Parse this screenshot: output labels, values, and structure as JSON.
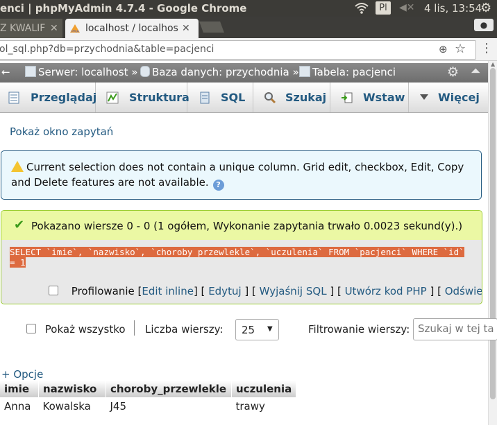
{
  "os_bar": {
    "window_title": "enci | phpMyAdmin 4.7.4 - Google Chrome",
    "keyboard_layout": "Pl",
    "clock": "4 lis, 13:54"
  },
  "browser": {
    "tabs": [
      {
        "label": "Z KWALIF"
      },
      {
        "label": "localhost / localhos"
      }
    ],
    "url": "ol_sql.php?db=przychodnia&table=pacjenci"
  },
  "breadcrumb": {
    "server": "Serwer: localhost »",
    "database": "Baza danych: przychodnia »",
    "table": "Tabela: pacjenci"
  },
  "menu_tabs": [
    {
      "label": "Przeglądaj",
      "icon": "browse-icon"
    },
    {
      "label": "Struktura",
      "icon": "structure-icon"
    },
    {
      "label": "SQL",
      "icon": "sql-icon"
    },
    {
      "label": "Szukaj",
      "icon": "search-icon"
    },
    {
      "label": "Wstaw",
      "icon": "insert-icon"
    },
    {
      "label": "Więcej",
      "icon": "chevron-down-icon"
    }
  ],
  "content": {
    "show_query_link": "Pokaż okno zapytań",
    "notice": "Current selection does not contain a unique column. Grid edit, checkbox, Edit, Copy and Delete features are not available.",
    "success_message": "Pokazano wiersze 0 - 0 (1 ogółem, Wykonanie zapytania trwało 0.0023 sekund(y).)",
    "sql_query": "SELECT `imie`, `nazwisko`, `choroby przewlekle`, `uczulenia` FROM `pacjenci` WHERE `id` = 1",
    "profiling_label": "Profilowanie",
    "links": {
      "edit_inline": "Edit inline",
      "edit": "Edytuj",
      "explain": "Wyjaśnij SQL",
      "php": "Utwórz kod PHP",
      "refresh": "Odśwież"
    },
    "show_all_label": "Pokaż wszystko",
    "rows_label": "Liczba wierszy:",
    "rows_value": "25",
    "filter_label": "Filtrowanie wierszy:",
    "filter_placeholder": "Szukaj w tej ta",
    "options_link": "+ Opcje"
  },
  "results": {
    "columns": [
      "imie",
      "nazwisko",
      "choroby_przewlekle",
      "uczulenia"
    ],
    "rows": [
      [
        "Anna",
        "Kowalska",
        "J45",
        "trawy"
      ]
    ]
  },
  "colors": {
    "link": "#235a81",
    "success_bg": "#ebf8a4",
    "notice_bg": "#ebf8fd",
    "sql_highlight": "#dd6a3f"
  }
}
